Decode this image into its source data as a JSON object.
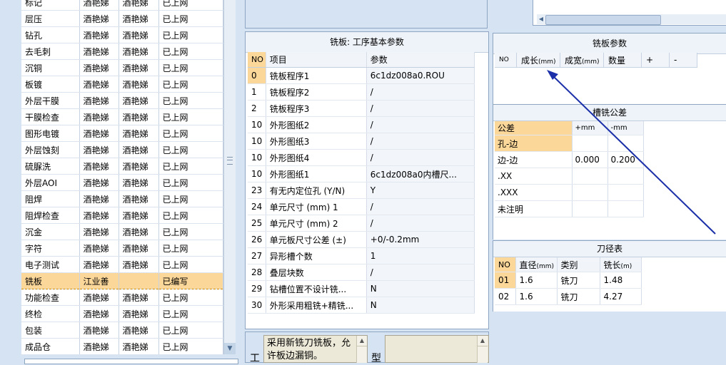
{
  "process_list": {
    "rows": [
      {
        "name": "标记",
        "c1": "酒艳娣",
        "c2": "酒艳娣",
        "status": "已上网"
      },
      {
        "name": "层压",
        "c1": "酒艳娣",
        "c2": "酒艳娣",
        "status": "已上网"
      },
      {
        "name": "钻孔",
        "c1": "酒艳娣",
        "c2": "酒艳娣",
        "status": "已上网"
      },
      {
        "name": "去毛刺",
        "c1": "酒艳娣",
        "c2": "酒艳娣",
        "status": "已上网"
      },
      {
        "name": "沉铜",
        "c1": "酒艳娣",
        "c2": "酒艳娣",
        "status": "已上网"
      },
      {
        "name": "板镀",
        "c1": "酒艳娣",
        "c2": "酒艳娣",
        "status": "已上网"
      },
      {
        "name": "外层干膜",
        "c1": "酒艳娣",
        "c2": "酒艳娣",
        "status": "已上网"
      },
      {
        "name": "干膜检查",
        "c1": "酒艳娣",
        "c2": "酒艳娣",
        "status": "已上网"
      },
      {
        "name": "图形电镀",
        "c1": "酒艳娣",
        "c2": "酒艳娣",
        "status": "已上网"
      },
      {
        "name": "外层蚀刻",
        "c1": "酒艳娣",
        "c2": "酒艳娣",
        "status": "已上网"
      },
      {
        "name": "硫脲洗",
        "c1": "酒艳娣",
        "c2": "酒艳娣",
        "status": "已上网"
      },
      {
        "name": "外层AOI",
        "c1": "酒艳娣",
        "c2": "酒艳娣",
        "status": "已上网"
      },
      {
        "name": "阻焊",
        "c1": "酒艳娣",
        "c2": "酒艳娣",
        "status": "已上网"
      },
      {
        "name": "阻焊检查",
        "c1": "酒艳娣",
        "c2": "酒艳娣",
        "status": "已上网"
      },
      {
        "name": "沉金",
        "c1": "酒艳娣",
        "c2": "酒艳娣",
        "status": "已上网"
      },
      {
        "name": "字符",
        "c1": "酒艳娣",
        "c2": "酒艳娣",
        "status": "已上网"
      },
      {
        "name": "电子测试",
        "c1": "酒艳娣",
        "c2": "酒艳娣",
        "status": "已上网"
      },
      {
        "name": "铣板",
        "c1": "江业善",
        "c2": "",
        "status": "已编写"
      },
      {
        "name": "功能检查",
        "c1": "酒艳娣",
        "c2": "酒艳娣",
        "status": "已上网"
      },
      {
        "name": "终检",
        "c1": "酒艳娣",
        "c2": "酒艳娣",
        "status": "已上网"
      },
      {
        "name": "包装",
        "c1": "酒艳娣",
        "c2": "酒艳娣",
        "status": "已上网"
      },
      {
        "name": "成品仓",
        "c1": "酒艳娣",
        "c2": "酒艳娣",
        "status": "已上网"
      }
    ]
  },
  "params_panel": {
    "title": "铣板: 工序基本参数",
    "headers": {
      "no": "NO",
      "item": "项目",
      "value": "参数"
    },
    "rows": [
      {
        "no": "0",
        "item": "铣板程序1",
        "value": "6c1dz008a0.ROU"
      },
      {
        "no": "1",
        "item": "铣板程序2",
        "value": "/"
      },
      {
        "no": "2",
        "item": "铣板程序3",
        "value": "/"
      },
      {
        "no": "10",
        "item": "外形图纸2",
        "value": "/"
      },
      {
        "no": "10",
        "item": "外形图纸3",
        "value": "/"
      },
      {
        "no": "10",
        "item": "外形图纸4",
        "value": "/"
      },
      {
        "no": "10",
        "item": "外形图纸1",
        "value": "6c1dz008a0内槽尺..."
      },
      {
        "no": "23",
        "item": "有无内定位孔 (Y/N)",
        "value": "Y"
      },
      {
        "no": "24",
        "item": "单元尺寸 (mm) 1",
        "value": "/"
      },
      {
        "no": "25",
        "item": "单元尺寸 (mm) 2",
        "value": "/"
      },
      {
        "no": "26",
        "item": "单元板尺寸公差 (±)",
        "value": "+0/-0.2mm"
      },
      {
        "no": "27",
        "item": "异形槽个数",
        "value": "1"
      },
      {
        "no": "28",
        "item": "叠层块数",
        "value": "/"
      },
      {
        "no": "29",
        "item": "钻槽位置不设计铣...",
        "value": "N"
      },
      {
        "no": "30",
        "item": "外形采用粗铣+精铣...",
        "value": "N"
      }
    ]
  },
  "plate_panel": {
    "title": "铣板参数",
    "headers": {
      "no": "NO",
      "growth": "成长",
      "growth_unit": "(mm)",
      "width": "成宽",
      "width_unit": "(mm)",
      "qty": "数量",
      "plus": "+",
      "minus": "-"
    }
  },
  "tolerance_panel": {
    "title": "槽铣公差",
    "headers": {
      "name": "公差",
      "plus": "+mm",
      "minus": "-mm"
    },
    "rows": [
      {
        "name": "孔-边",
        "plus": "",
        "minus": ""
      },
      {
        "name": "边-边",
        "plus": "0.000",
        "minus": "0.200"
      },
      {
        "name": ".XX",
        "plus": "",
        "minus": ""
      },
      {
        "name": ".XXX",
        "plus": "",
        "minus": ""
      },
      {
        "name": "未注明",
        "plus": "",
        "minus": ""
      }
    ]
  },
  "tool_panel": {
    "title": "刀径表",
    "headers": {
      "no": "NO",
      "dia": "直径",
      "dia_unit": "(mm)",
      "type": "类别",
      "len": "铣长",
      "len_unit": "(m)"
    },
    "rows": [
      {
        "no": "01",
        "dia": "1.6",
        "type": "铣刀",
        "len": "1.48"
      },
      {
        "no": "02",
        "dia": "1.6",
        "type": "铣刀",
        "len": "4.27"
      }
    ]
  },
  "bottom": {
    "memo_label": "工",
    "memo_text": "采用新铣刀铣板，允许板边漏铜。",
    "type_label": "型"
  },
  "colors": {
    "selection": "#fcd79a",
    "annotation_arrow": "#1a2fa8",
    "panel_bg": "#d6e3f2"
  },
  "icons": [
    "scroll-down-arrow-icon",
    "scroll-left-arrow-icon",
    "scroll-up-arrow-icon",
    "annotation-arrow"
  ]
}
